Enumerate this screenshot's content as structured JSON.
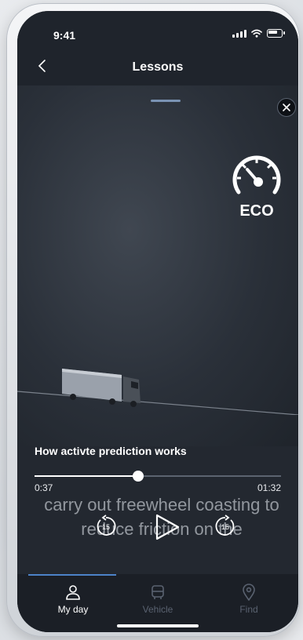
{
  "status_bar": {
    "time": "9:41"
  },
  "header": {
    "title": "Lessons"
  },
  "video": {
    "eco_label": "ECO",
    "lesson_title": "How activte prediction works",
    "current_time": "0:37",
    "total_time": "01:32",
    "progress": 0.42,
    "subtitle_lines": [
      "carry out freewheel coasting to",
      "reduce friction on the"
    ],
    "rewind_seconds": "15",
    "forward_seconds": "15"
  },
  "tabs": [
    {
      "label": "My day",
      "icon": "person-icon",
      "active": true
    },
    {
      "label": "Vehicle",
      "icon": "truck-front-icon",
      "active": false
    },
    {
      "label": "Find",
      "icon": "location-pin-icon",
      "active": false
    }
  ],
  "colors": {
    "accent": "#4c83c9",
    "background": "#232830",
    "inactive_tab": "#5a6270"
  }
}
